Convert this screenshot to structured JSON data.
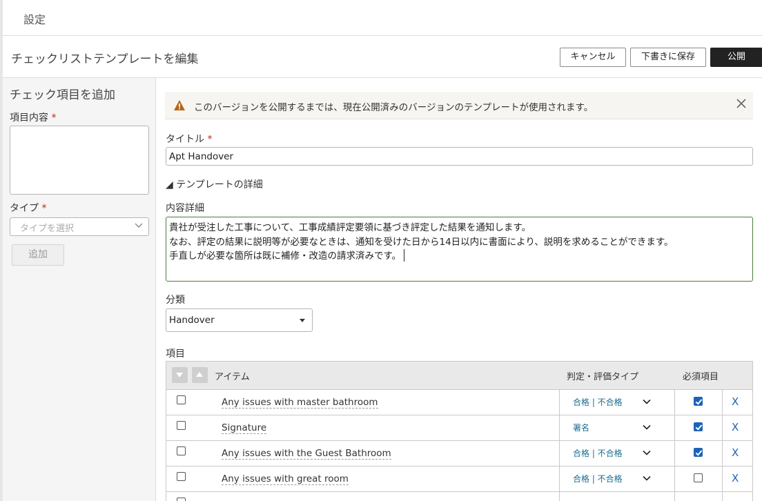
{
  "topbar": {
    "breadcrumb": "設定"
  },
  "header": {
    "title": "チェックリストテンプレートを編集",
    "cancel_label": "キャンセル",
    "save_draft_label": "下書きに保存",
    "publish_label": "公開"
  },
  "add_panel": {
    "heading": "チェック項目を追加",
    "content_label": "項目内容",
    "type_label": "タイプ",
    "type_placeholder": "タイプを選択",
    "add_label": "追加",
    "required_mark": "*"
  },
  "alert": {
    "message": "このバージョンを公開するまでは、現在公開済みのバージョンのテンプレートが使用されます。",
    "icon": "warning-icon",
    "color": "#b8651b"
  },
  "form": {
    "title_label": "タイトル",
    "required_mark": "*",
    "title_value": "Apt Handover",
    "details_toggle": "◢ テンプレートの詳細",
    "description_label": "内容詳細",
    "description_lines": [
      "貴社が受注した工事について、工事成績評定要領に基づき評定した結果を通知します。",
      "なお、評定の結果に説明等が必要なときは、通知を受けた日から14日以内に書面により、説明を求めることができます。",
      "手直しが必要な箇所は既に補修・改造の請求済みです。"
    ],
    "category_label": "分類",
    "category_value": "Handover",
    "items_label": "項目"
  },
  "table": {
    "headers": {
      "item": "アイテム",
      "eval_type": "判定・評価タイプ",
      "required": "必須項目"
    },
    "rows": [
      {
        "name": "Any issues with master bathroom",
        "eval": "合格 | 不合格",
        "required": true,
        "delete": "X"
      },
      {
        "name": "Signature",
        "eval": "署名",
        "required": true,
        "delete": "X"
      },
      {
        "name": "Any issues with the Guest Bathroom",
        "eval": "合格 | 不合格",
        "required": true,
        "delete": "X"
      },
      {
        "name": "Any issues with great room",
        "eval": "合格 | 不合格",
        "required": false,
        "delete": "X"
      }
    ]
  },
  "colors": {
    "accent_blue": "#1c63b7",
    "link_teal": "#1a6e8e",
    "required_red": "#c0281c",
    "focus_green": "#4c7a3a"
  }
}
